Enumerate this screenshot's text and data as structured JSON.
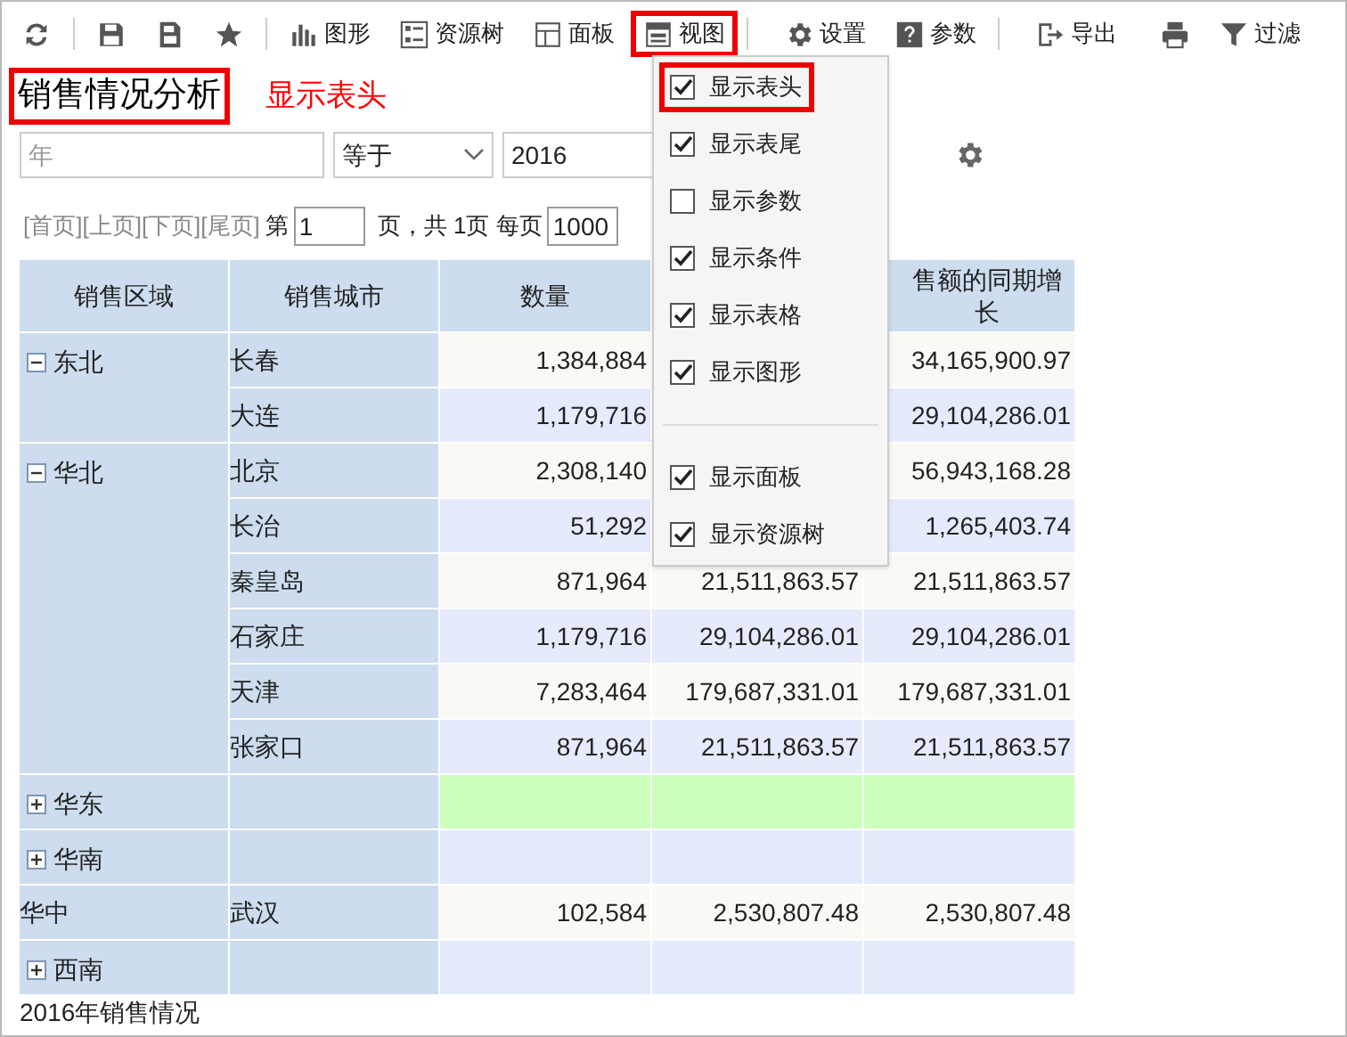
{
  "toolbar": [
    {
      "kind": "refresh",
      "selected": false
    },
    {
      "kind": "save",
      "selected": false
    },
    {
      "kind": "save-as",
      "selected": false
    },
    {
      "kind": "star",
      "selected": false
    },
    {
      "kind": "chart",
      "label": "图形",
      "selected": false
    },
    {
      "kind": "tree",
      "label": "资源树",
      "selected": false
    },
    {
      "kind": "panel",
      "label": "面板",
      "selected": false
    },
    {
      "kind": "view",
      "label": "视图",
      "selected": true
    },
    {
      "kind": "gear",
      "label": "设置",
      "selected": false
    },
    {
      "kind": "help",
      "label": "参数",
      "selected": false
    },
    {
      "kind": "export",
      "label": "导出",
      "selected": false
    },
    {
      "kind": "print",
      "selected": false
    },
    {
      "kind": "filter",
      "label": "过滤",
      "selected": false
    }
  ],
  "title": "销售情况分析",
  "annotation": "显示表头",
  "filter": {
    "field_placeholder": "年",
    "operator": "等于",
    "value": "2016"
  },
  "pager": {
    "links": "[首页][上页][下页][尾页]",
    "page_prefix": "第",
    "page": "1",
    "page_suffix": "页，共 1页 每页",
    "per_page": "1000"
  },
  "view_menu": [
    {
      "label": "显示表头",
      "checked": true,
      "highlighted": true
    },
    {
      "label": "显示表尾",
      "checked": true,
      "highlighted": false
    },
    {
      "label": "显示参数",
      "checked": false,
      "highlighted": false
    },
    {
      "label": "显示条件",
      "checked": true,
      "highlighted": false
    },
    {
      "label": "显示表格",
      "checked": true,
      "highlighted": false
    },
    {
      "label": "显示图形",
      "checked": true,
      "highlighted": false
    },
    {
      "kind": "divider"
    },
    {
      "label": "显示面板",
      "checked": true,
      "highlighted": false
    },
    {
      "label": "显示资源树",
      "checked": true,
      "highlighted": false
    }
  ],
  "table": {
    "columns": [
      "销售区域",
      "销售城市",
      "数量",
      null,
      "售额的同期增长"
    ],
    "regions": [
      {
        "name": "东北",
        "kind": "group",
        "expanded": true,
        "rows": [
          [
            "长春",
            "1,384,884",
            null,
            "34,165,900.97"
          ],
          [
            "大连",
            "1,179,716",
            null,
            "29,104,286.01"
          ]
        ]
      },
      {
        "name": "华北",
        "kind": "group",
        "expanded": true,
        "rows": [
          [
            "北京",
            "2,308,140",
            null,
            "56,943,168.28"
          ],
          [
            "长治",
            "51,292",
            null,
            "1,265,403.74"
          ],
          [
            "秦皇岛",
            "871,964",
            "21,511,863.57",
            "21,511,863.57"
          ],
          [
            "石家庄",
            "1,179,716",
            "29,104,286.01",
            "29,104,286.01"
          ],
          [
            "天津",
            "7,283,464",
            "179,687,331.01",
            "179,687,331.01"
          ],
          [
            "张家口",
            "871,964",
            "21,511,863.57",
            "21,511,863.57"
          ]
        ]
      },
      {
        "name": "华东",
        "kind": "group",
        "expanded": false,
        "highlighted": true
      },
      {
        "name": "华南",
        "kind": "group",
        "expanded": false
      },
      {
        "name": "华中",
        "kind": "single",
        "rows": [
          [
            "武汉",
            "102,584",
            "2,530,807.48",
            "2,530,807.48"
          ]
        ]
      },
      {
        "name": "西南",
        "kind": "group",
        "expanded": false
      }
    ]
  },
  "footer": "2016年销售情况"
}
